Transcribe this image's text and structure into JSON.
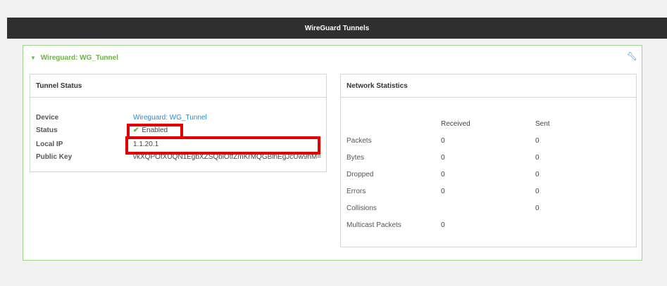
{
  "header": {
    "title": "WireGuard Tunnels"
  },
  "section": {
    "title": "Wireguard: WG_Tunnel",
    "expand_icon": "triangle-down-icon",
    "edit_icon": "wrench-icon"
  },
  "tunnel_status": {
    "title": "Tunnel Status",
    "rows": [
      {
        "label": "Device",
        "value": "Wireguard: WG_Tunnel"
      },
      {
        "label": "Status",
        "value": "Enabled"
      },
      {
        "label": "Local IP",
        "value": "1.1.20.1"
      },
      {
        "label": "Public Key",
        "value": "vkXQPOfXUQN1EgbXZSQblOtfZmKrMQGBlhEgJcUw9hM="
      }
    ]
  },
  "network_statistics": {
    "title": "Network Statistics",
    "columns": [
      "Received",
      "Sent"
    ],
    "rows": [
      {
        "label": "Packets",
        "received": "0",
        "sent": "0"
      },
      {
        "label": "Bytes",
        "received": "0",
        "sent": "0"
      },
      {
        "label": "Dropped",
        "received": "0",
        "sent": "0"
      },
      {
        "label": "Errors",
        "received": "0",
        "sent": "0"
      },
      {
        "label": "Collisions",
        "received": "",
        "sent": "0"
      },
      {
        "label": "Multicast Packets",
        "received": "0",
        "sent": ""
      }
    ]
  },
  "colors": {
    "accent_green": "#6db24b",
    "link_blue": "#2a8bd3",
    "highlight_red": "#e30000",
    "header_bg": "#2f2f2f"
  }
}
